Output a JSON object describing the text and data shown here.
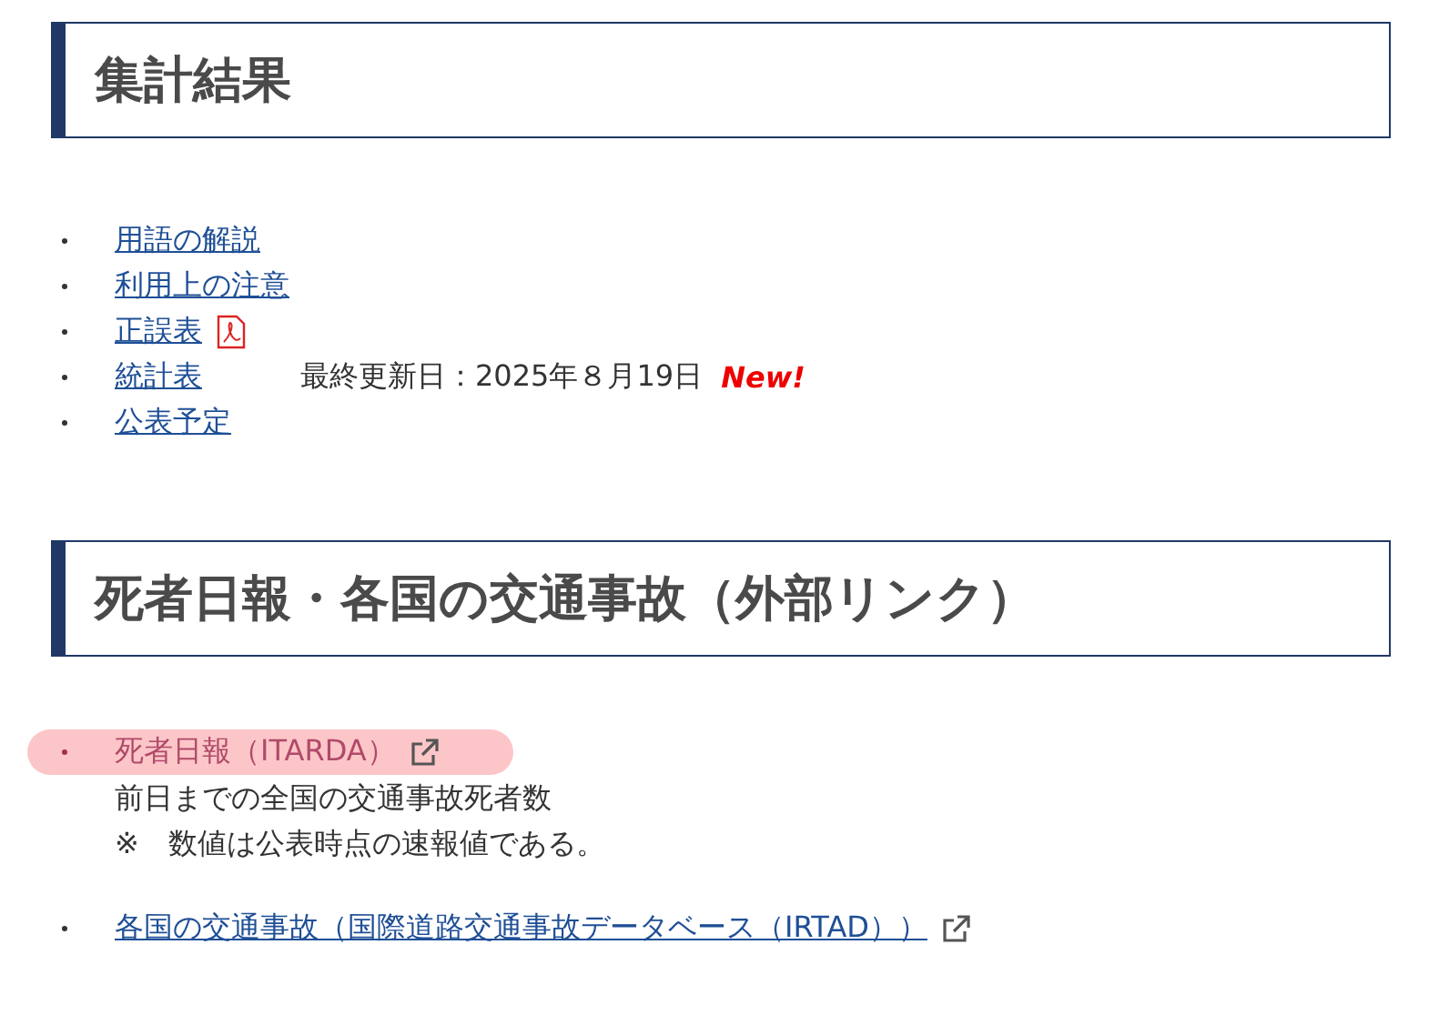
{
  "sections": [
    {
      "title": "集計結果",
      "items": [
        {
          "label": "用語の解説",
          "kind": "link",
          "hovered": false
        },
        {
          "label": "利用上の注意",
          "kind": "link",
          "hovered": false
        },
        {
          "label": "正誤表",
          "kind": "pdf",
          "hovered": false
        },
        {
          "label": "統計表",
          "kind": "link",
          "hovered": false,
          "note": "最終更新日：2025年８月19日",
          "badge": "New!"
        },
        {
          "label": "公表予定",
          "kind": "link",
          "hovered": false
        }
      ]
    },
    {
      "title": "死者日報・各国の交通事故（外部リンク）",
      "items": [
        {
          "label": "死者日報（ITARDA）",
          "kind": "external",
          "hovered": true,
          "description": [
            "前日までの全国の交通事故死者数",
            "※　数値は公表時点の速報値である。"
          ]
        },
        {
          "label": "各国の交通事故（国際道路交通事故データベース（IRTAD））",
          "kind": "external",
          "hovered": false
        }
      ]
    }
  ]
}
